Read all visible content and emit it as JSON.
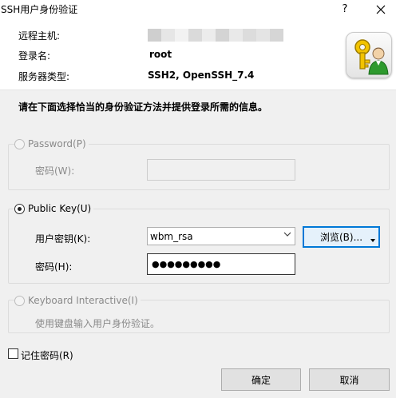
{
  "window": {
    "title": "SSH用户身份验证",
    "help_glyph": "?",
    "close_glyph": "✕"
  },
  "info": {
    "host_label": "远程主机:",
    "login_label": "登录名:",
    "login_value": "root",
    "server_type_label": "服务器类型:",
    "server_type_value": "SSH2, OpenSSH_7.4"
  },
  "instruction": "请在下面选择恰当的身份验证方法并提供登录所需的信息。",
  "password_group": {
    "radio_label": "Password(P)",
    "password_label": "密码(W):",
    "enabled": false
  },
  "publickey_group": {
    "radio_label": "Public Key(U)",
    "selected": true,
    "user_key_label": "用户密钥(K):",
    "user_key_value": "wbm_rsa",
    "browse_label": "浏览(B)...",
    "passphrase_label": "密码(H):",
    "passphrase_value": "●●●●●●●●●"
  },
  "keyboard_group": {
    "radio_label": "Keyboard Interactive(I)",
    "description": "使用键盘输入用户身份验证。",
    "enabled": false
  },
  "remember_password": {
    "label": "记住密码(R)",
    "checked": false
  },
  "footer": {
    "ok_label": "确定",
    "cancel_label": "取消"
  },
  "colors": {
    "focus_accent": "#0078d7",
    "dialog_bg": "#f0f0f0"
  }
}
